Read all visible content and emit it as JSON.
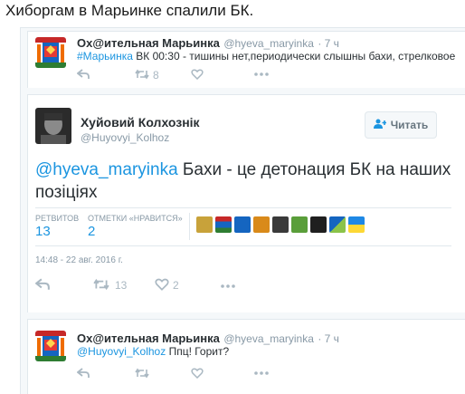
{
  "headline": "Хиборгам в Марьинке спалили БК.",
  "top_tweet": {
    "name": "Ох@ительная Марьинка",
    "handle": "@hyeva_maryinka",
    "time": "· 7 ч",
    "hashtag": "#Марьинка",
    "text": " ВК 00:30 - тишины нет,периодически слышны бахи, стрелковое",
    "retweet_count": "8"
  },
  "main_tweet": {
    "name": "Хуйовий Колхознік",
    "handle": "@Huyovyi_Kolhoz",
    "follow_label": "Читать",
    "mention": "@hyeva_maryinka",
    "text": " Бахи - це детонация БК на наших позіціях",
    "retweets_label": "РЕТВИТОВ",
    "retweets_count": "13",
    "likes_label": "ОТМЕТКИ «НРАВИТСЯ»",
    "likes_count": "2",
    "timestamp": "14:48 - 22 авг. 2016 г.",
    "action_retweet_count": "13",
    "action_like_count": "2"
  },
  "reply_tweet": {
    "name": "Ох@ительная Марьинка",
    "handle": "@hyeva_maryinka",
    "time": "· 7 ч",
    "mention": "@Huyovyi_Kolhoz",
    "text": " Ппц! Горит?"
  },
  "colors": {
    "link": "#1b95e0",
    "muted": "#8899a6",
    "icon": "#aab8c2",
    "border": "#e1e8ed"
  }
}
